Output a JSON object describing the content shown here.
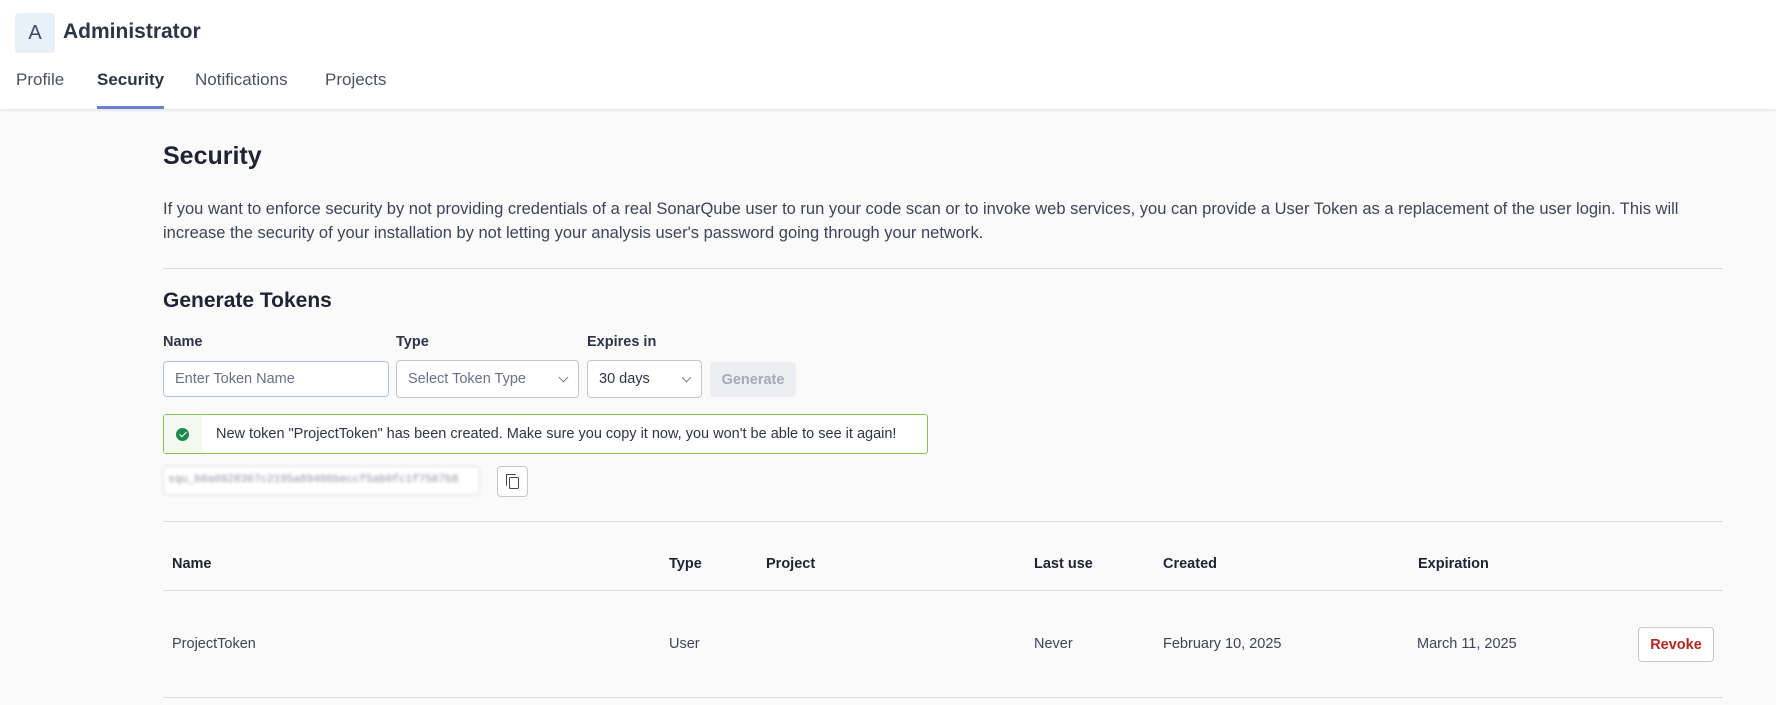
{
  "header": {
    "avatar_initial": "A",
    "username": "Administrator",
    "tabs": [
      {
        "label": "Profile"
      },
      {
        "label": "Security"
      },
      {
        "label": "Notifications"
      },
      {
        "label": "Projects"
      }
    ],
    "active_tab": "Security"
  },
  "main": {
    "title": "Security",
    "description": "If you want to enforce security by not providing credentials of a real SonarQube user to run your code scan or to invoke web services, you can provide a User Token as a replacement of the user login. This will increase the security of your installation by not letting your analysis user's password going through your network.",
    "generate": {
      "title": "Generate Tokens",
      "name_label": "Name",
      "name_placeholder": "Enter Token Name",
      "name_value": "",
      "type_label": "Type",
      "type_value": "Select Token Type",
      "expires_label": "Expires in",
      "expires_value": "30 days",
      "generate_label": "Generate"
    },
    "alert": {
      "message": "New token \"ProjectToken\" has been created. Make sure you copy it now, you won't be able to see it again!",
      "status_color": "#85c05a"
    },
    "token_value": "squ_b0a0928367c2195a89406beccf5ab0fc1f7567b8",
    "table": {
      "headers": [
        "Name",
        "Type",
        "Project",
        "Last use",
        "Created",
        "Expiration"
      ],
      "rows": [
        {
          "name": "ProjectToken",
          "type": "User",
          "project": "",
          "last_use": "Never",
          "created": "February 10, 2025",
          "expiration": "March 11, 2025",
          "action": "Revoke"
        }
      ]
    }
  },
  "colors": {
    "accent": "#6d7fd0",
    "danger": "#b3261e",
    "success": "#1e8a4c"
  }
}
